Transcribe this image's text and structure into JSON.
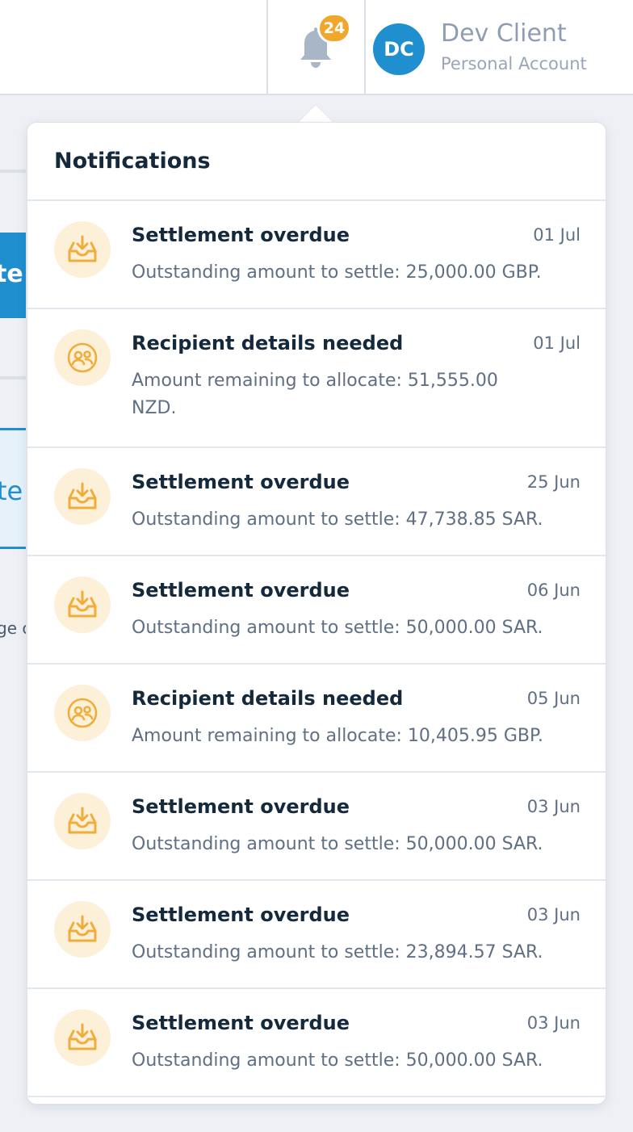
{
  "header": {
    "notification_count": "24",
    "account": {
      "initials": "DC",
      "name": "Dev Client",
      "type": "Personal Account"
    }
  },
  "background": {
    "button_fragment": "te",
    "box_fragment": "te",
    "text_fragment": "ge c"
  },
  "notifications": {
    "title": "Notifications",
    "items": [
      {
        "icon": "inbox-download-icon",
        "title": "Settlement overdue",
        "date": "01 Jul",
        "message": "Outstanding amount to settle: 25,000.00 GBP."
      },
      {
        "icon": "users-icon",
        "title": "Recipient details needed",
        "date": "01 Jul",
        "message": "Amount remaining to allocate: 51,555.00 NZD."
      },
      {
        "icon": "inbox-download-icon",
        "title": "Settlement overdue",
        "date": "25 Jun",
        "message": "Outstanding amount to settle: 47,738.85 SAR."
      },
      {
        "icon": "inbox-download-icon",
        "title": "Settlement overdue",
        "date": "06 Jun",
        "message": "Outstanding amount to settle: 50,000.00 SAR."
      },
      {
        "icon": "users-icon",
        "title": "Recipient details needed",
        "date": "05 Jun",
        "message": "Amount remaining to allocate: 10,405.95 GBP."
      },
      {
        "icon": "inbox-download-icon",
        "title": "Settlement overdue",
        "date": "03 Jun",
        "message": "Outstanding amount to settle: 50,000.00 SAR."
      },
      {
        "icon": "inbox-download-icon",
        "title": "Settlement overdue",
        "date": "03 Jun",
        "message": "Outstanding amount to settle: 23,894.57 SAR."
      },
      {
        "icon": "inbox-download-icon",
        "title": "Settlement overdue",
        "date": "03 Jun",
        "message": "Outstanding amount to settle: 50,000.00 SAR."
      }
    ]
  },
  "colors": {
    "accent": "#1f8fd0",
    "badge": "#f0a72c",
    "icon_bg": "#fdf0d8",
    "icon_stroke": "#f0ad3a"
  }
}
